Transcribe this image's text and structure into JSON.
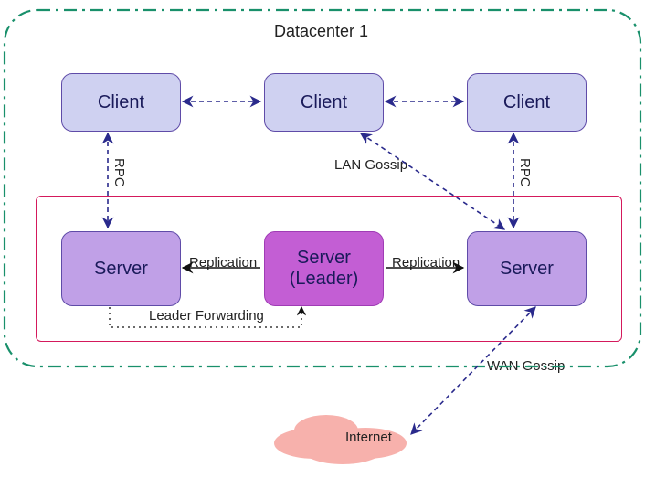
{
  "title": "Datacenter 1",
  "clients": [
    "Client",
    "Client",
    "Client"
  ],
  "servers": {
    "left": "Server",
    "leader": "Server\n(Leader)",
    "right": "Server"
  },
  "labels": {
    "rpc_left": "RPC",
    "rpc_right": "RPC",
    "replication_left": "Replication",
    "replication_right": "Replication",
    "leader_forwarding": "Leader Forwarding",
    "lan_gossip": "LAN Gossip",
    "wan_gossip": "WAN Gossip",
    "internet": "Internet"
  },
  "chart_data": {
    "type": "table",
    "description": "Network/cluster architecture diagram for a single datacenter.",
    "nodes": [
      {
        "id": "c1",
        "kind": "client",
        "label": "Client"
      },
      {
        "id": "c2",
        "kind": "client",
        "label": "Client"
      },
      {
        "id": "c3",
        "kind": "client",
        "label": "Client"
      },
      {
        "id": "s1",
        "kind": "server",
        "label": "Server"
      },
      {
        "id": "s2",
        "kind": "server-leader",
        "label": "Server (Leader)"
      },
      {
        "id": "s3",
        "kind": "server",
        "label": "Server"
      },
      {
        "id": "net",
        "kind": "internet",
        "label": "Internet"
      }
    ],
    "edges": [
      {
        "from": "c1",
        "to": "c2",
        "label": "",
        "style": "dashed",
        "bidir": true
      },
      {
        "from": "c2",
        "to": "c3",
        "label": "",
        "style": "dashed",
        "bidir": true
      },
      {
        "from": "c1",
        "to": "s1",
        "label": "RPC",
        "style": "dashed",
        "bidir": true
      },
      {
        "from": "c3",
        "to": "s3",
        "label": "RPC",
        "style": "dashed",
        "bidir": true
      },
      {
        "from": "c2",
        "to": "s3",
        "label": "LAN Gossip",
        "style": "dashed",
        "bidir": true
      },
      {
        "from": "s2",
        "to": "s1",
        "label": "Replication",
        "style": "solid",
        "bidir": false
      },
      {
        "from": "s2",
        "to": "s3",
        "label": "Replication",
        "style": "solid",
        "bidir": false
      },
      {
        "from": "s1",
        "to": "s2",
        "label": "Leader Forwarding",
        "style": "dotted",
        "bidir": false
      },
      {
        "from": "s3",
        "to": "net",
        "label": "WAN Gossip",
        "style": "dashed",
        "bidir": true
      }
    ],
    "groups": [
      {
        "id": "dc1",
        "label": "Datacenter 1",
        "members": [
          "c1",
          "c2",
          "c3",
          "s1",
          "s2",
          "s3"
        ]
      },
      {
        "id": "srvgrp",
        "label": "",
        "members": [
          "s1",
          "s2",
          "s3"
        ]
      }
    ]
  }
}
